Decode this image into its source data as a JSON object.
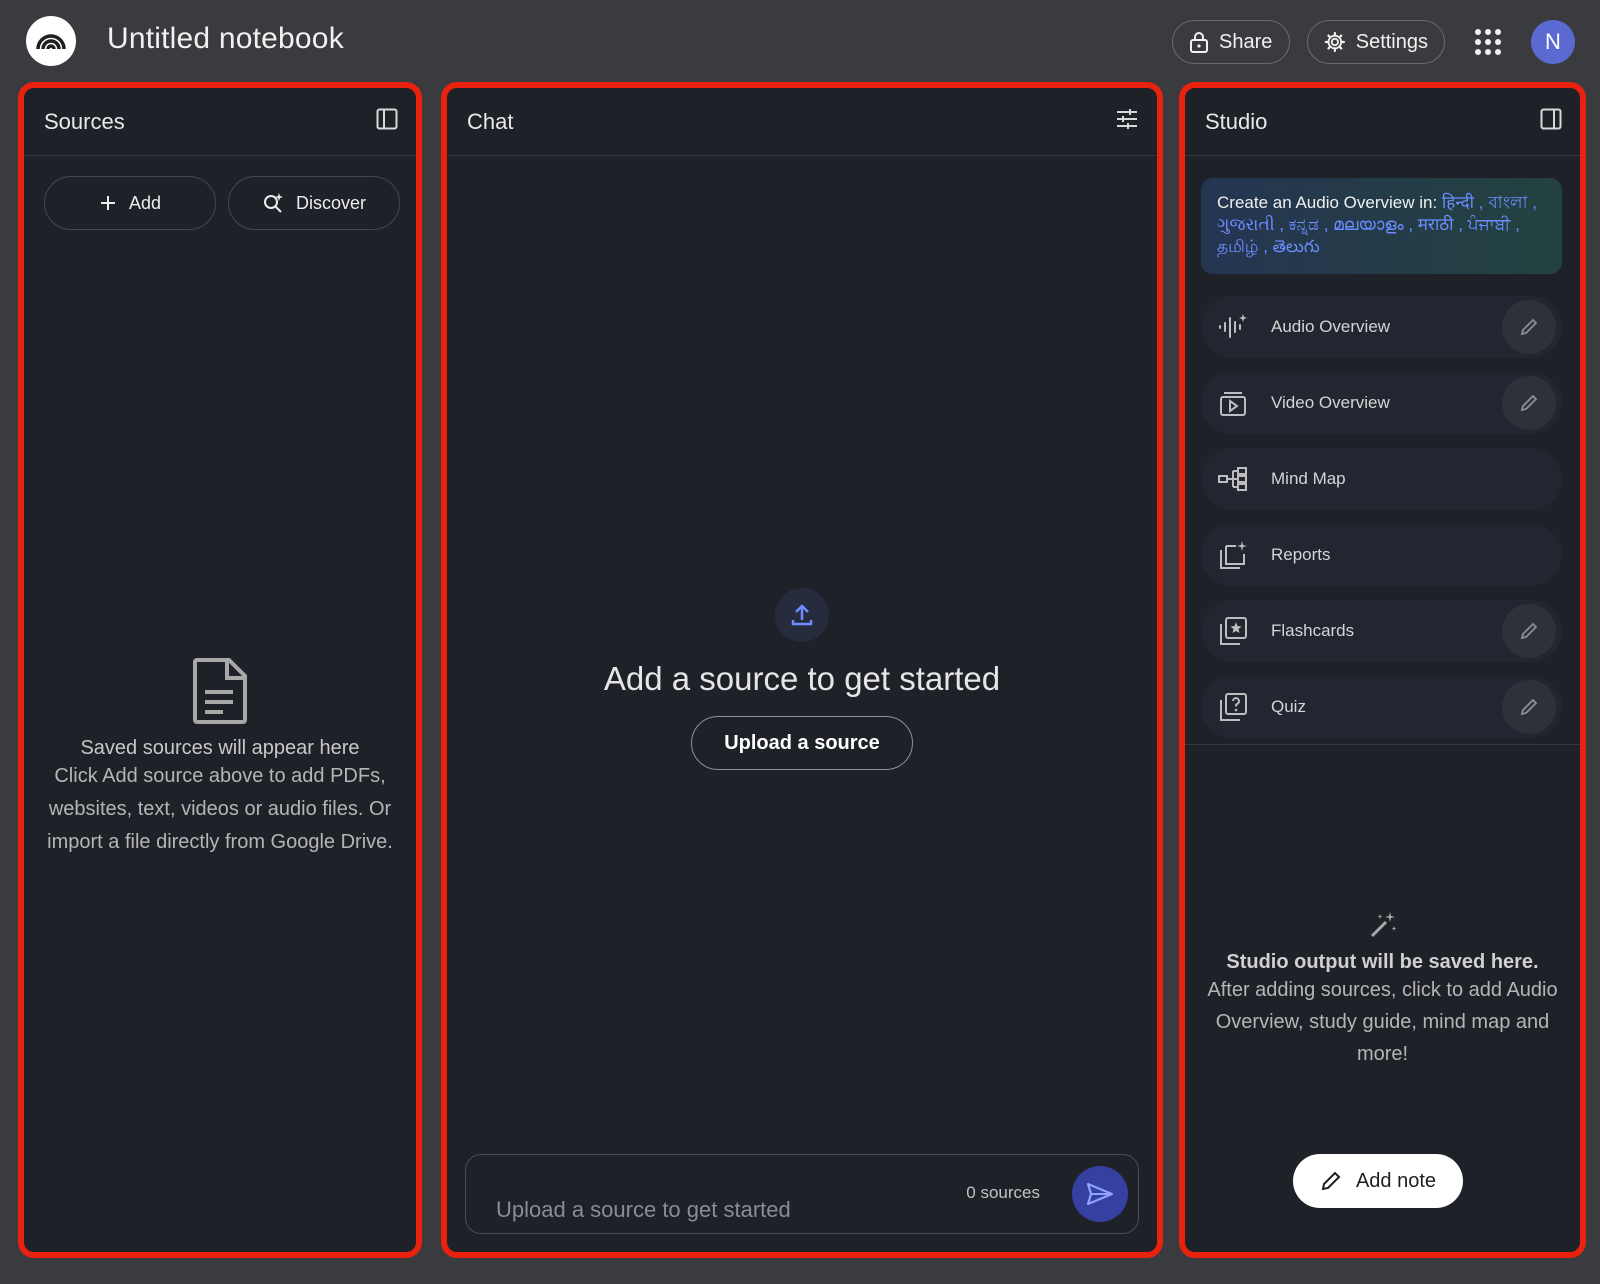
{
  "header": {
    "title": "Untitled notebook",
    "share_label": "Share",
    "settings_label": "Settings",
    "avatar_initial": "N"
  },
  "sources": {
    "title": "Sources",
    "add_label": "Add",
    "discover_label": "Discover",
    "empty_title": "Saved sources will appear here",
    "empty_text": "Click Add source above to add PDFs, websites, text, videos or audio files. Or import a file directly from Google Drive."
  },
  "chat": {
    "title": "Chat",
    "headline": "Add a source to get started",
    "upload_label": "Upload a source",
    "input_placeholder": "Upload a source to get started",
    "source_count": "0 sources"
  },
  "studio": {
    "title": "Studio",
    "banner_prefix": "Create an Audio Overview in:",
    "banner_languages": "हिन्दी , বাংলা , ગુજરાતી , ಕನ್ನಡ , മലയാളം , मराठी , ਪੰਜਾਬੀ , தமிழ் , తెలుగు",
    "tools": [
      {
        "label": "Audio Overview",
        "icon": "audio-waveform-icon",
        "editable": true
      },
      {
        "label": "Video Overview",
        "icon": "video-play-icon",
        "editable": true
      },
      {
        "label": "Mind Map",
        "icon": "mind-map-icon",
        "editable": false
      },
      {
        "label": "Reports",
        "icon": "reports-icon",
        "editable": false
      },
      {
        "label": "Flashcards",
        "icon": "flashcards-icon",
        "editable": true
      },
      {
        "label": "Quiz",
        "icon": "quiz-icon",
        "editable": true
      }
    ],
    "empty_title": "Studio output will be saved here.",
    "empty_text": "After adding sources, click to add Audio Overview, study guide, mind map and more!",
    "add_note_label": "Add note"
  },
  "colors": {
    "highlight_border": "#e8220e",
    "panel_bg": "#1f2128",
    "page_bg": "#3a3b3f",
    "accent": "#6c8cff",
    "send_bg": "#3540a0",
    "avatar_bg": "#5b6ad0"
  }
}
